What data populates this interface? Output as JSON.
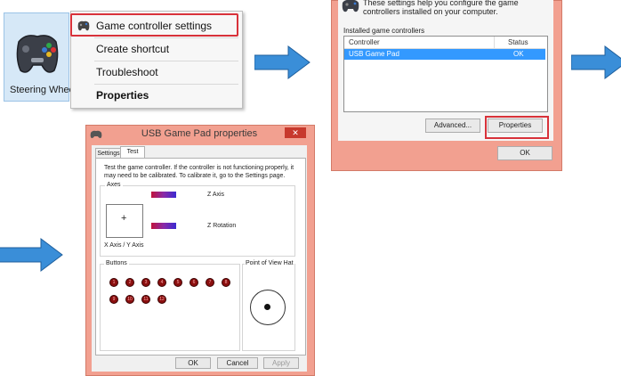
{
  "step1": {
    "icon_label": "Steering Wheel",
    "menu_items": [
      "Game controller settings",
      "Create shortcut",
      "Troubleshoot",
      "Properties"
    ]
  },
  "step2": {
    "header": "These settings help you configure the game controllers installed on your computer.",
    "group_label": "Installed game controllers",
    "columns": [
      "Controller",
      "Status"
    ],
    "rows": [
      {
        "controller": "USB Game Pad",
        "status": "OK"
      }
    ],
    "buttons": {
      "advanced": "Advanced...",
      "properties": "Properties",
      "ok": "OK"
    }
  },
  "step3": {
    "title": "USB Game Pad  properties",
    "close": "✕",
    "tabs": [
      "Settings",
      "Test"
    ],
    "description": "Test the game controller.  If the controller is not functioning properly, it may need to be calibrated.  To calibrate it, go to the Settings page.",
    "axes": {
      "group": "Axes",
      "xy": "X Axis / Y Axis",
      "crosshair": "+",
      "z_axis": "Z Axis",
      "z_rotation": "Z Rotation"
    },
    "buttons_group": "Buttons",
    "button_numbers": [
      "1",
      "2",
      "3",
      "4",
      "5",
      "6",
      "7",
      "8",
      "9",
      "10",
      "11",
      "12"
    ],
    "pov_label": "Point of View Hat",
    "actions": {
      "ok": "OK",
      "cancel": "Cancel",
      "apply": "Apply"
    }
  },
  "colors": {
    "highlight": "#d8323a",
    "arrow": "#3a8ed8",
    "dialog_frame": "#f2a090",
    "selection": "#3399ff"
  }
}
